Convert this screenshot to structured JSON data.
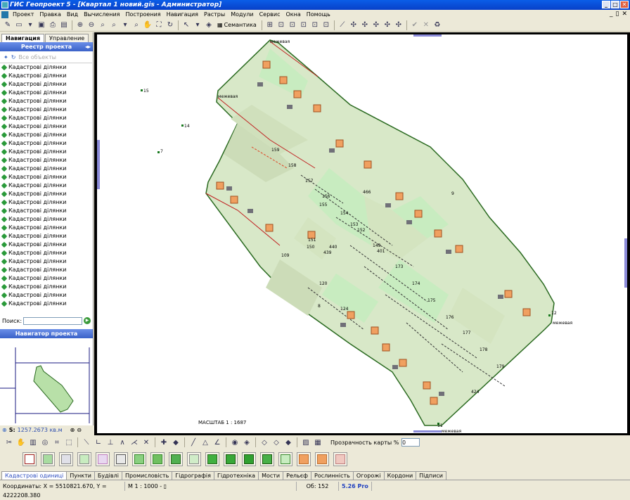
{
  "window": {
    "title": "ГИС Геопроект 5 - [Квартал 1 новий.gis - Администратор]",
    "min": "_",
    "max": "□",
    "close": "✕",
    "mdi_min": "_",
    "mdi_restore": "▯",
    "mdi_close": "✕"
  },
  "menu": [
    "Проект",
    "Правка",
    "Вид",
    "Вычисления",
    "Построения",
    "Навигация",
    "Растры",
    "Модули",
    "Сервис",
    "Окна",
    "Помощь"
  ],
  "toolbar": {
    "semantics_label": "Семантика"
  },
  "left_panel": {
    "tabs": [
      "Навигация",
      "Управление"
    ],
    "registry_title": "Реестр проекта",
    "all_objects": "Все объекты",
    "items": [
      "Кадастрові ділянки",
      "Кадастрові ділянки",
      "Кадастрові ділянки",
      "Кадастрові ділянки",
      "Кадастрові ділянки",
      "Кадастрові ділянки",
      "Кадастрові ділянки",
      "Кадастрові ділянки",
      "Кадастрові ділянки",
      "Кадастрові ділянки",
      "Кадастрові ділянки",
      "Кадастрові ділянки",
      "Кадастрові ділянки",
      "Кадастрові ділянки",
      "Кадастрові ділянки",
      "Кадастрові ділянки",
      "Кадастрові ділянки",
      "Кадастрові ділянки",
      "Кадастрові ділянки",
      "Кадастрові ділянки",
      "Кадастрові ділянки",
      "Кадастрові ділянки",
      "Кадастрові ділянки",
      "Кадастрові ділянки",
      "Кадастрові ділянки",
      "Кадастрові ділянки",
      "Кадастрові ділянки",
      "Кадастрові ділянки",
      "Кадастрові ділянки"
    ],
    "search_label": "Поиск:",
    "navigator_title": "Навигатор проекта",
    "area_label": "S:",
    "area_value": "1257.2673 кв.м"
  },
  "map": {
    "scale_label": "МАСШТАБ 1 : 1687",
    "boundary_label": "межевая",
    "point_labels": [
      "15",
      "14",
      "7",
      "12",
      "11",
      "157",
      "156",
      "155",
      "154",
      "153",
      "152",
      "151",
      "150",
      "149",
      "440",
      "439",
      "401",
      "173",
      "174",
      "175",
      "176",
      "177",
      "178",
      "179",
      "424",
      "158",
      "159",
      "466",
      "8",
      "9",
      "109",
      "120",
      "124"
    ]
  },
  "bottom_toolbar": {
    "opacity_label": "Прозрачность карты %",
    "opacity_value": "0"
  },
  "swatches": [
    {
      "fill": "#ffffff",
      "border": "#a02020"
    },
    {
      "fill": "#a8dca0",
      "border": "#888"
    },
    {
      "fill": "#e0e0e8",
      "border": "#888"
    },
    {
      "fill": "#c8ecc0",
      "border": "#888"
    },
    {
      "fill": "#e8d8f0",
      "border": "#c080c0"
    },
    {
      "fill": "#e8e8e8",
      "border": "#555"
    },
    {
      "fill": "#8ad080",
      "border": "#3a8a30"
    },
    {
      "fill": "#70c060",
      "border": "#3a8a30"
    },
    {
      "fill": "#50b050",
      "border": "#2a6a20"
    },
    {
      "fill": "#d0ecc8",
      "border": "#888"
    },
    {
      "fill": "#40b040",
      "border": "#2a6a20"
    },
    {
      "fill": "#38a838",
      "border": "#1a5a10"
    },
    {
      "fill": "#30a030",
      "border": "#1a5a10"
    },
    {
      "fill": "#48b048",
      "border": "#1a5a10"
    },
    {
      "fill": "#c8ecc0",
      "border": "#3a8a30"
    },
    {
      "fill": "#f0a060",
      "border": "#c07030"
    },
    {
      "fill": "#f0a060",
      "border": "#c07030"
    },
    {
      "fill": "#f0c8c0",
      "border": "#c08080"
    }
  ],
  "layer_tabs": [
    "Кадастрові одиниці",
    "Пункти",
    "Будівлі",
    "Промисловість",
    "Гідрографія",
    "Гідротехніка",
    "Мости",
    "Рельєф",
    "Рослинність",
    "Огорожі",
    "Кордони",
    "Підписи"
  ],
  "status": {
    "coords": "Координаты: X = 5510821.670, Y = 4222208.380",
    "scale": "М 1 : 1000 - ▯",
    "objects": "Об: 152",
    "version": "5.26 Pro"
  },
  "colors": {
    "title_bar": "#0a4ed8",
    "panel_header": "#4a72d8",
    "parcel_fill": "#d8e8c8",
    "parcel_light": "#c8ecc0",
    "building_orange": "#f0a060",
    "building_gray": "#707078",
    "boundary_red": "#c02020",
    "marker_green": "#1a7a20"
  }
}
